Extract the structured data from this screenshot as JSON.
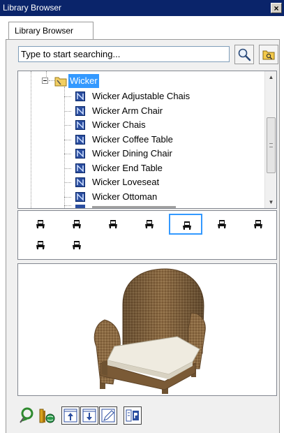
{
  "window": {
    "title": "Library Browser",
    "close_glyph": "×"
  },
  "tab": {
    "label": "Library Browser"
  },
  "search": {
    "placeholder": "Type to start searching...",
    "value": ""
  },
  "tree": {
    "folder": {
      "label": "Wicker",
      "icon": "folder-icon",
      "expander": "minus"
    },
    "items": [
      {
        "label": "Wicker Adjustable Chais"
      },
      {
        "label": "Wicker Arm Chair"
      },
      {
        "label": "Wicker Chais"
      },
      {
        "label": "Wicker Coffee Table"
      },
      {
        "label": "Wicker Dining Chair"
      },
      {
        "label": "Wicker End Table"
      },
      {
        "label": "Wicker Loveseat"
      },
      {
        "label": "Wicker Ottoman"
      }
    ]
  },
  "view_angles": {
    "count": 9,
    "selected_index": 4,
    "icon": "chair-view-icon"
  },
  "preview": {
    "subject": "wicker-arm-chair-render"
  },
  "bottom_toolbar": {
    "items": [
      "tree-refresh-icon",
      "catalog-web-icon",
      "move-up-icon",
      "move-down-icon",
      "edit-icon",
      "properties-icon"
    ]
  },
  "colors": {
    "title_bar": "#0a246a",
    "selection": "#3399ff",
    "wicker": "#8b6a43",
    "cushion": "#eeeadf"
  }
}
